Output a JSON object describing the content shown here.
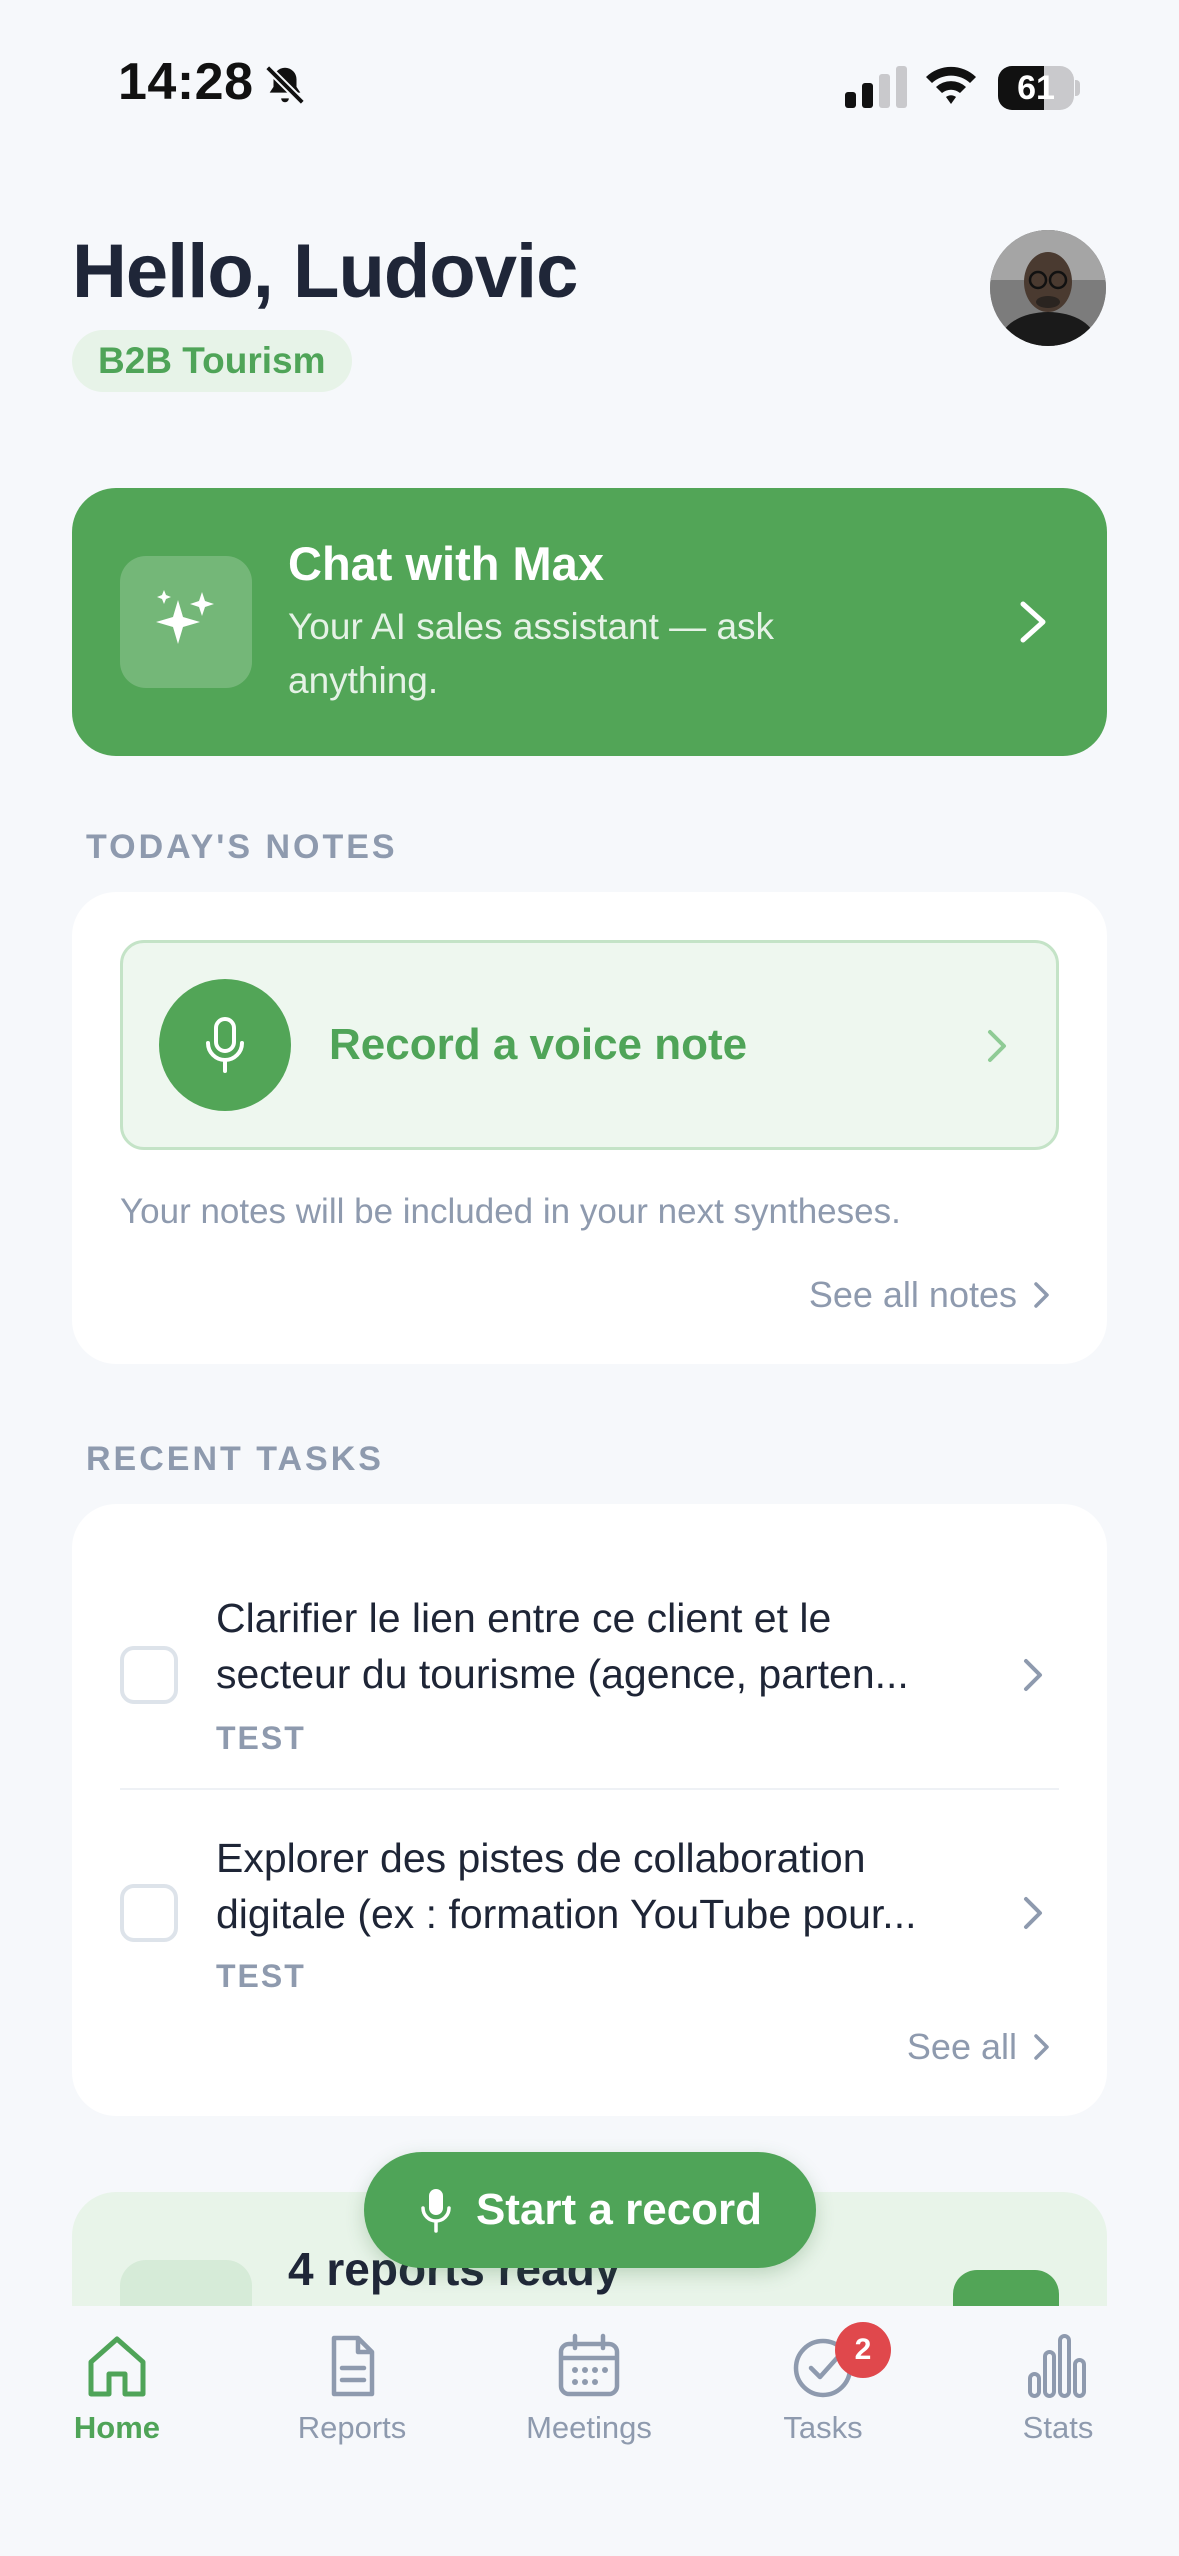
{
  "status_bar": {
    "time": "14:28",
    "battery": "61",
    "battery_level": 0.61
  },
  "header": {
    "greeting": "Hello, Ludovic",
    "badge": "B2B Tourism"
  },
  "chat_banner": {
    "title": "Chat with Max",
    "subtitle": "Your AI sales assistant — ask anything."
  },
  "notes": {
    "section_label": "TODAY'S NOTES",
    "record_label": "Record a voice note",
    "hint": "Your notes will be included in your next syntheses.",
    "see_all": "See all notes"
  },
  "tasks": {
    "section_label": "RECENT TASKS",
    "items": [
      {
        "text": "Clarifier le lien entre ce client et le secteur du tourisme (agence, parten...",
        "tag": "TEST"
      },
      {
        "text": "Explorer des pistes de collaboration digitale (ex : formation YouTube pour...",
        "tag": "TEST"
      }
    ],
    "see_all": "See all"
  },
  "reports": {
    "title": "4 reports ready"
  },
  "start_record": {
    "label": "Start a record"
  },
  "tabbar": {
    "items": [
      {
        "label": "Home",
        "icon": "home-icon",
        "active": true
      },
      {
        "label": "Reports",
        "icon": "document-icon"
      },
      {
        "label": "Meetings",
        "icon": "calendar-icon"
      },
      {
        "label": "Tasks",
        "icon": "check-circle-icon",
        "badge": "2"
      },
      {
        "label": "Stats",
        "icon": "bar-chart-icon"
      }
    ]
  },
  "colors": {
    "accent": "#52A557",
    "background": "#F6F8FB",
    "badge_red": "#E0484C",
    "muted": "#8E9AAE"
  }
}
